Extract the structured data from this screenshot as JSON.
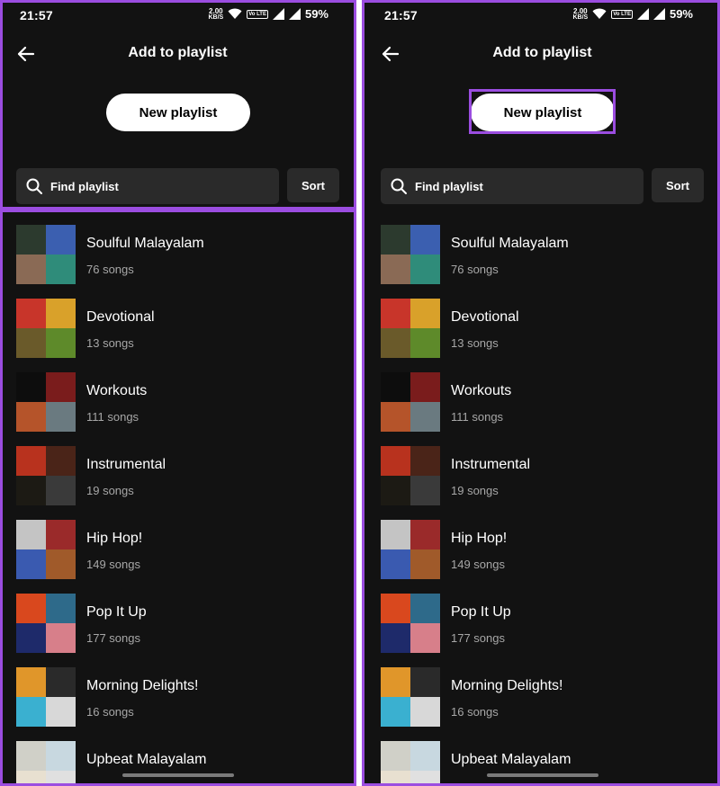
{
  "status_bar": {
    "time": "21:57",
    "net_speed": "2.00",
    "net_unit": "KB/S",
    "volte": "Vo LTE",
    "battery": "59%"
  },
  "header": {
    "title": "Add to playlist"
  },
  "new_playlist_label": "New playlist",
  "search": {
    "placeholder": "Find playlist"
  },
  "sort_label": "Sort",
  "playlists": [
    {
      "name": "Soulful Malayalam",
      "count": "76 songs",
      "cover_colors": [
        "#2c3a2e",
        "#3b5fb0",
        "#8a6a55",
        "#2f8c7a"
      ]
    },
    {
      "name": "Devotional",
      "count": "13 songs",
      "cover_colors": [
        "#c8352a",
        "#d9a12a",
        "#6a5a2a",
        "#5e8a2a"
      ]
    },
    {
      "name": "Workouts",
      "count": "111 songs",
      "cover_colors": [
        "#0d0d0d",
        "#7a1c1c",
        "#b5542a",
        "#6a7a80"
      ]
    },
    {
      "name": "Instrumental",
      "count": "19 songs",
      "cover_colors": [
        "#b8321e",
        "#4a2418",
        "#1c1a14",
        "#3a3a3a"
      ]
    },
    {
      "name": "Hip Hop!",
      "count": "149 songs",
      "cover_colors": [
        "#c4c4c4",
        "#9a2a2a",
        "#3a5ab0",
        "#a05a2a"
      ]
    },
    {
      "name": "Pop It Up",
      "count": "177 songs",
      "cover_colors": [
        "#d9481e",
        "#2e6a8a",
        "#1e2a6a",
        "#d77f8a"
      ]
    },
    {
      "name": "Morning Delights!",
      "count": "16 songs",
      "cover_colors": [
        "#e0962a",
        "#2a2a2a",
        "#3ab0d0",
        "#d8d8d8"
      ]
    },
    {
      "name": "Upbeat Malayalam",
      "count": "",
      "cover_colors": [
        "#d0d0c8",
        "#c8d8e0",
        "#e8e0d0",
        "#e0e0e0"
      ]
    }
  ],
  "highlight_color": "#9b4de0"
}
